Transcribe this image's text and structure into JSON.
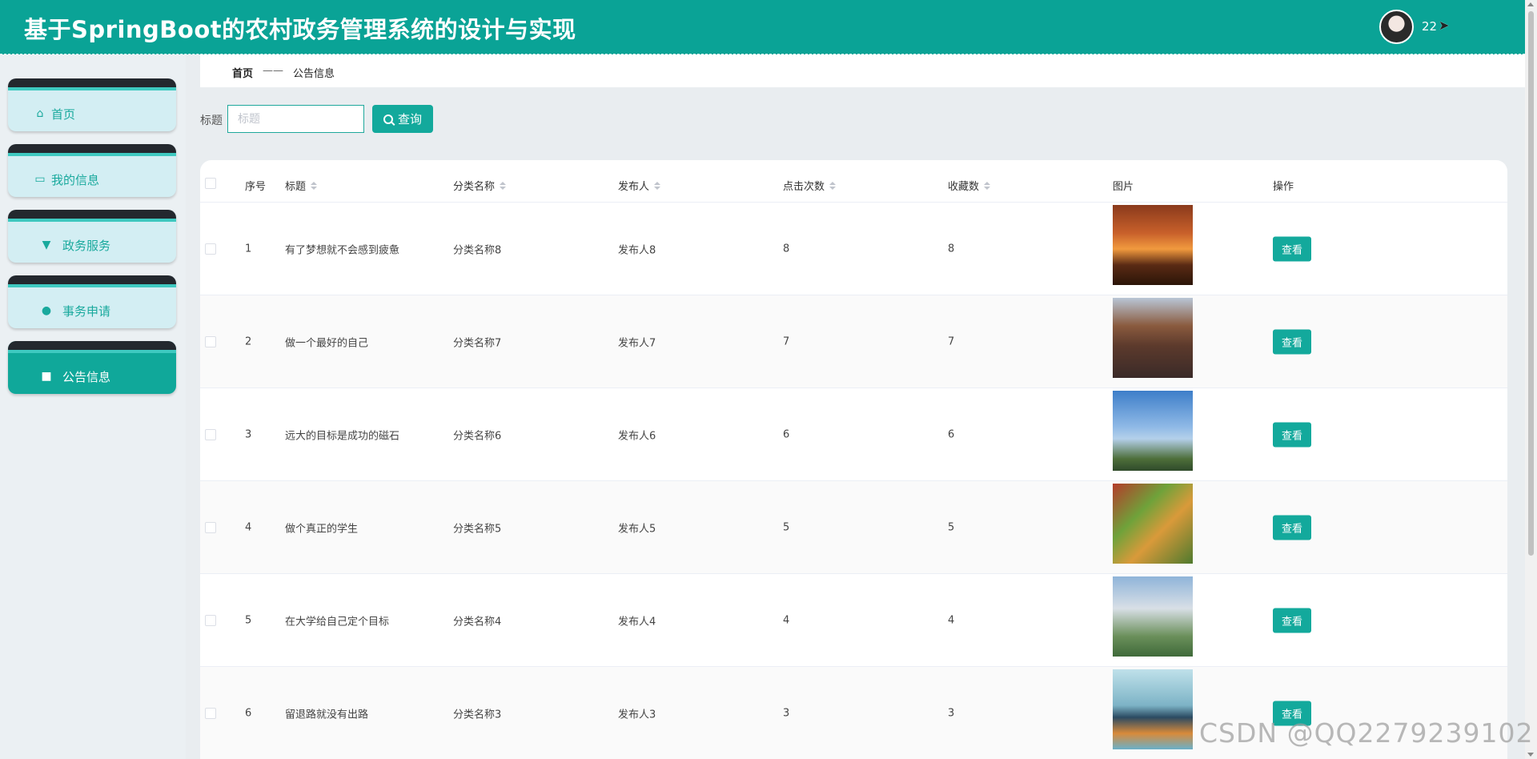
{
  "header": {
    "title": "基于SpringBoot的农村政务管理系统的设计与实现",
    "username": "22"
  },
  "sidebar": {
    "items": [
      {
        "label": "首页",
        "icon": "home-icon"
      },
      {
        "label": "我的信息",
        "icon": "card-icon"
      },
      {
        "label": "政务服务",
        "icon": "stamp-icon"
      },
      {
        "label": "事务申请",
        "icon": "user-icon"
      },
      {
        "label": "公告信息",
        "icon": "briefcase-icon",
        "active": true
      }
    ]
  },
  "breadcrumb": {
    "home": "首页",
    "separator": "——",
    "current": "公告信息"
  },
  "search": {
    "label": "标题",
    "placeholder": "标题",
    "button": "查询"
  },
  "table": {
    "columns": [
      "序号",
      "标题",
      "分类名称",
      "发布人",
      "点击次数",
      "收藏数",
      "图片",
      "操作"
    ],
    "rows": [
      {
        "index": "1",
        "title": "有了梦想就不会感到疲惫",
        "category": "分类名称8",
        "publisher": "发布人8",
        "clicks": "8",
        "favorites": "8",
        "image": "night-city-photo",
        "action": "查看"
      },
      {
        "index": "2",
        "title": "做一个最好的自己",
        "category": "分类名称7",
        "publisher": "发布人7",
        "clicks": "7",
        "favorites": "7",
        "image": "street-buildings-photo",
        "action": "查看"
      },
      {
        "index": "3",
        "title": "远大的目标是成功的磁石",
        "category": "分类名称6",
        "publisher": "发布人6",
        "clicks": "6",
        "favorites": "6",
        "image": "statue-of-liberty-photo",
        "action": "查看"
      },
      {
        "index": "4",
        "title": "做个真正的学生",
        "category": "分类名称5",
        "publisher": "发布人5",
        "clicks": "5",
        "favorites": "5",
        "image": "isometric-town-photo",
        "action": "查看"
      },
      {
        "index": "5",
        "title": "在大学给自己定个目标",
        "category": "分类名称4",
        "publisher": "发布人4",
        "clicks": "4",
        "favorites": "4",
        "image": "apartment-building-photo",
        "action": "查看"
      },
      {
        "index": "6",
        "title": "留退路就没有出路",
        "category": "分类名称3",
        "publisher": "发布人3",
        "clicks": "3",
        "favorites": "3",
        "image": "city-illustration-photo",
        "action": "查看"
      }
    ]
  },
  "watermark": "CSDN @QQ2279239102",
  "colors": {
    "primary": "#13a99c",
    "header": "#0aa396",
    "sidebar_bg": "#ebf0f3"
  }
}
